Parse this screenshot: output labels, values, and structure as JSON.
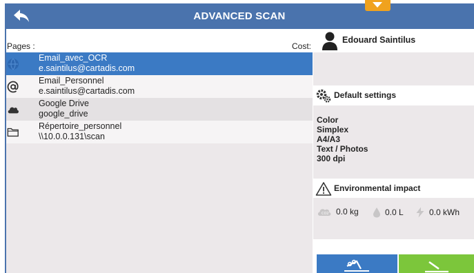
{
  "header": {
    "title": "ADVANCED SCAN",
    "back_icon": "back-arrow-icon",
    "menu_icon": "chevron-down-icon"
  },
  "list": {
    "pages_label": "Pages :",
    "cost_label": "Cost:",
    "items": [
      {
        "name": "Email_avec_OCR",
        "sub": "e.saintilus@cartadis.com",
        "icon": "globe-icon",
        "selected": true
      },
      {
        "name": "Email_Personnel",
        "sub": "e.saintilus@cartadis.com",
        "icon": "at-icon",
        "selected": false
      },
      {
        "name": "Google Drive",
        "sub": "google_drive",
        "icon": "cloud-icon",
        "selected": false
      },
      {
        "name": "Répertoire_personnel",
        "sub": "\\\\10.0.0.131\\scan",
        "icon": "folder-icon",
        "selected": false
      }
    ]
  },
  "user": {
    "name": "Edouard Saintilus",
    "icon": "user-icon"
  },
  "settings": {
    "title": "Default settings",
    "icon": "gears-icon",
    "lines": [
      "Color",
      "Simplex",
      "A4/A3",
      "Text / Photos",
      "300 dpi"
    ]
  },
  "environment": {
    "title": "Environmental impact",
    "icon": "warning-icon",
    "co2": "0.0 kg",
    "water": "0.0 L",
    "energy": "0.0 kWh"
  },
  "actions": {
    "scan_icon": "scanner-icon",
    "go_icon": "send-icon",
    "colors": {
      "blue": "#3b7ac4",
      "green": "#7cc63b",
      "header": "#4a73ad",
      "orange": "#f0a21e"
    }
  }
}
